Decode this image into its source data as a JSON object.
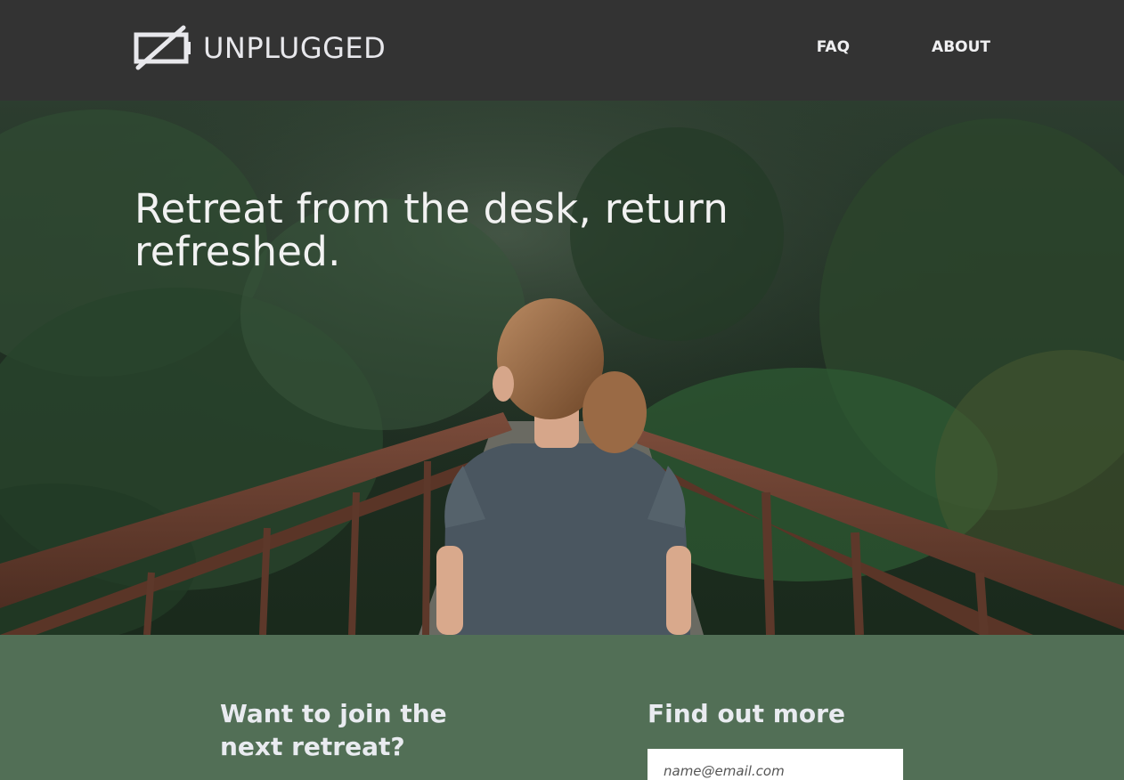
{
  "header": {
    "brand": "UNPLUGGED",
    "logo_icon": "battery-slash-icon",
    "nav": [
      {
        "label": "FAQ"
      },
      {
        "label": "ABOUT"
      }
    ]
  },
  "hero": {
    "headline": "Retreat from the desk, return refreshed.",
    "image": "woman-on-forest-bridge-photo"
  },
  "signup": {
    "join_heading": "Want to join the next retreat?",
    "more_heading": "Find out more",
    "email_placeholder": "name@email.com"
  },
  "colors": {
    "header_bg": "#333333",
    "section_bg": "#526f56",
    "text_light": "#e9ebf0"
  }
}
